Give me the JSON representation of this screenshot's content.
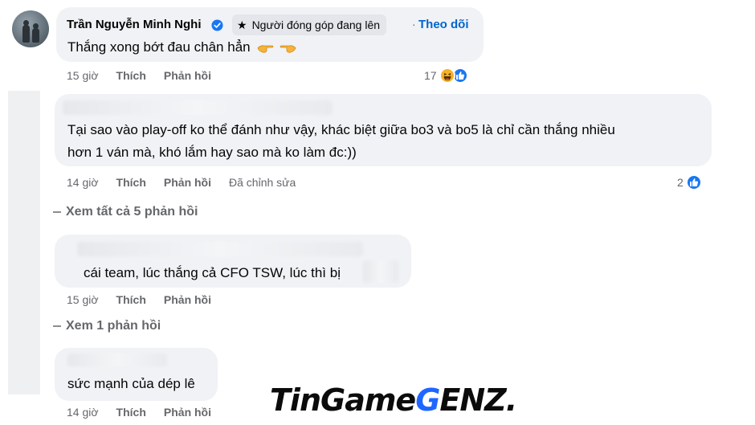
{
  "comment1": {
    "author": "Trần Nguyễn Minh Nghi",
    "badge": "Người đóng góp đang lên",
    "separator": "·",
    "follow": "Theo dõi",
    "text": "Thắng xong bớt đau chân hẳn",
    "time": "15 giờ",
    "like": "Thích",
    "reply": "Phản hồi",
    "reaction_count": "17",
    "reactions": [
      "haha-icon",
      "like-icon"
    ]
  },
  "comment2": {
    "text_line1": "Tại sao vào play-off ko thể đánh như vậy, khác biệt giữa bo3 và bo5 là chỉ cần thắng nhiều",
    "text_line2": "hơn 1 ván mà, khó lắm hay sao mà ko làm đc:))",
    "time": "14 giờ",
    "like": "Thích",
    "reply": "Phản hồi",
    "edited": "Đã chỉnh sửa",
    "reaction_count": "2",
    "reactions": [
      "like-icon"
    ]
  },
  "view_replies_1": "Xem tất cả 5 phản hồi",
  "comment3": {
    "text": "cái team, lúc thắng cả CFO TSW, lúc thì bị",
    "time": "15 giờ",
    "like": "Thích",
    "reply": "Phản hồi"
  },
  "view_replies_2": "Xem 1 phản hồi",
  "comment4": {
    "text": "sức mạnh của dép lê",
    "time": "14 giờ",
    "like": "Thích",
    "reply": "Phản hồi"
  },
  "watermark": {
    "part1": "TinGame",
    "part2": "G",
    "part3": "ENZ."
  },
  "colors": {
    "bubble": "#f0f2f5",
    "link_blue": "#0064d1",
    "meta_gray": "#65676b",
    "like_blue": "#1877f2",
    "haha_yellow": "#f7b125"
  }
}
